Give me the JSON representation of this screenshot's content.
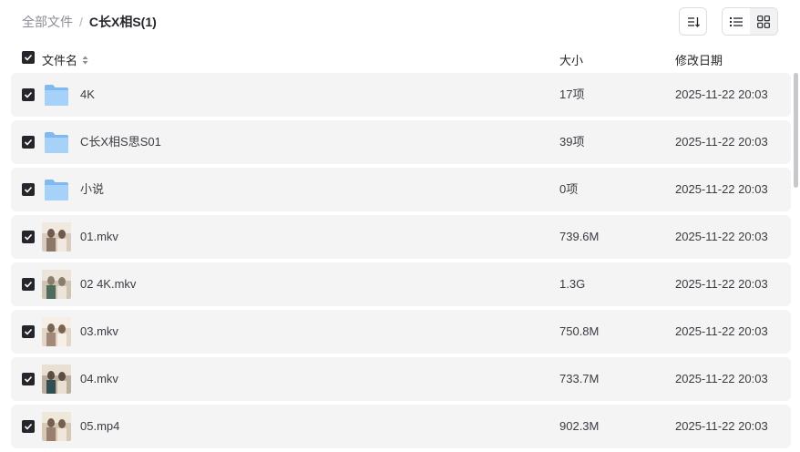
{
  "breadcrumb": {
    "root": "全部文件",
    "separator": "/",
    "current": "C长X相S(1)"
  },
  "toolbar": {
    "sort_icon": "sort-icon",
    "list_view_icon": "list-view-icon",
    "grid_view_icon": "grid-view-icon",
    "active_view": "list"
  },
  "columns": {
    "name": "文件名",
    "size": "大小",
    "date": "修改日期"
  },
  "files": [
    {
      "name": "4K",
      "size": "17项",
      "date": "2025-11-22 20:03",
      "type": "folder",
      "checked": true
    },
    {
      "name": "C长X相S思S01",
      "size": "39项",
      "date": "2025-11-22 20:03",
      "type": "folder",
      "checked": true
    },
    {
      "name": "小说",
      "size": "0项",
      "date": "2025-11-22 20:03",
      "type": "folder",
      "checked": true
    },
    {
      "name": "01.mkv",
      "size": "739.6M",
      "date": "2025-11-22 20:03",
      "type": "video",
      "checked": true
    },
    {
      "name": "02 4K.mkv",
      "size": "1.3G",
      "date": "2025-11-22 20:03",
      "type": "video",
      "checked": true
    },
    {
      "name": "03.mkv",
      "size": "750.8M",
      "date": "2025-11-22 20:03",
      "type": "video",
      "checked": true
    },
    {
      "name": "04.mkv",
      "size": "733.7M",
      "date": "2025-11-22 20:03",
      "type": "video",
      "checked": true
    },
    {
      "name": "05.mp4",
      "size": "902.3M",
      "date": "2025-11-22 20:03",
      "type": "video",
      "checked": true
    }
  ],
  "colors": {
    "checkbox": "#25262b",
    "folder": "#8cc4f5",
    "row_bg": "#f4f4f5"
  }
}
